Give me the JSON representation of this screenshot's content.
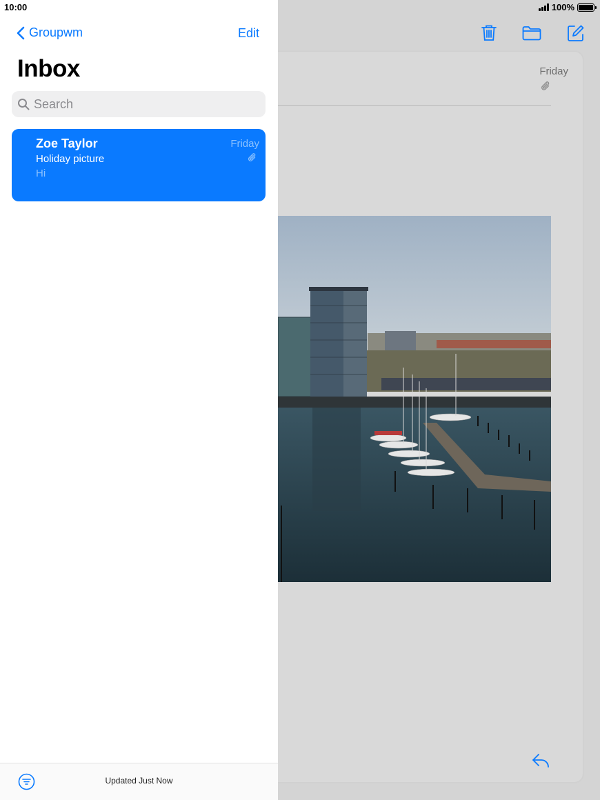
{
  "status": {
    "time": "10:00",
    "battery": "100%"
  },
  "sidebar": {
    "back_label": "Groupwm",
    "edit_label": "Edit",
    "title": "Inbox",
    "search_placeholder": "Search",
    "messages": [
      {
        "sender": "Zoe Taylor",
        "subject": "Holiday picture",
        "preview": "Hi",
        "date": "Friday",
        "has_attachment": true,
        "selected": true
      }
    ],
    "footer_status": "Updated Just Now"
  },
  "message": {
    "date": "Friday",
    "has_attachment": true
  },
  "icons": {
    "toolbar": [
      "trash-icon",
      "folder-icon",
      "compose-icon"
    ],
    "reply": "reply-icon",
    "filter": "filter-icon"
  },
  "colors": {
    "accent": "#0a7aff",
    "selected_row": "#0a7aff"
  }
}
